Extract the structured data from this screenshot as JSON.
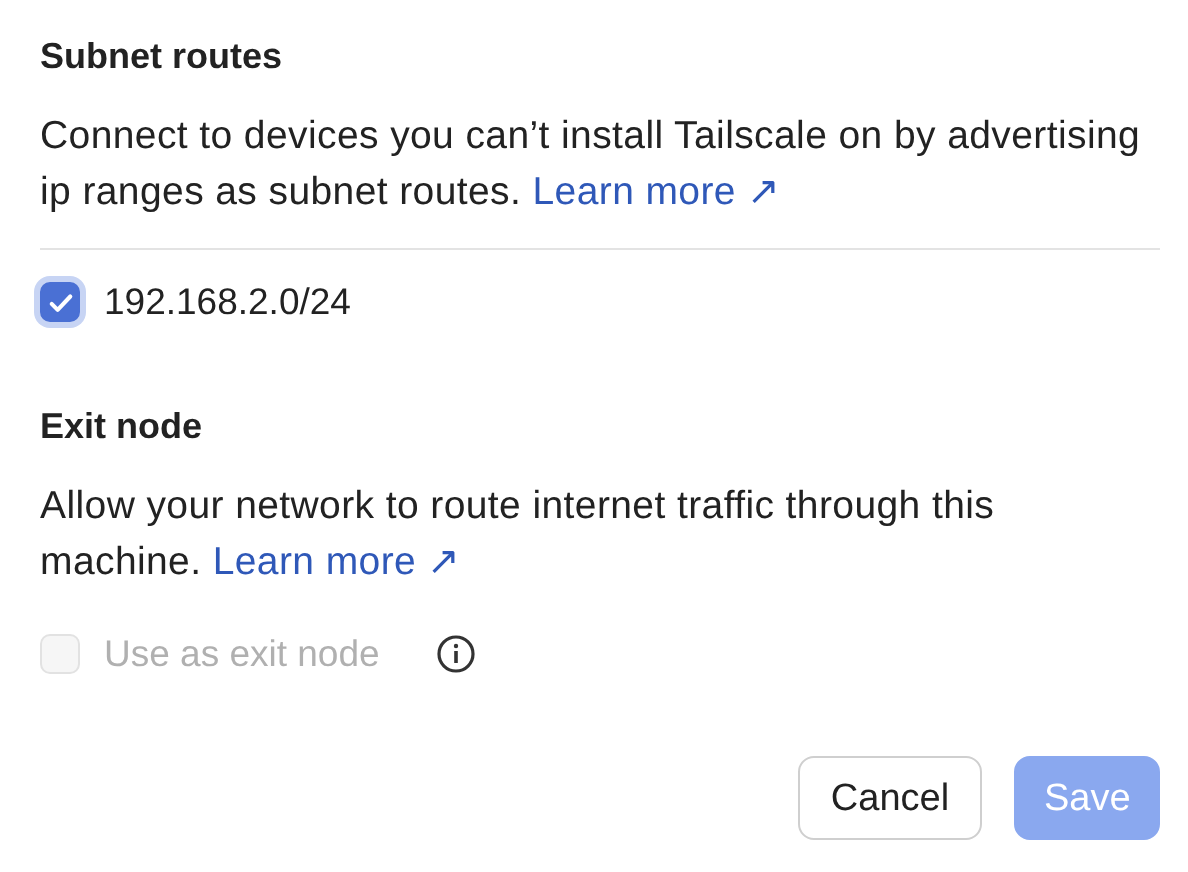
{
  "sections": [
    {
      "title": "Subnet routes",
      "description": "Connect to devices you can’t install Tailscale on by advertising ip ranges as subnet routes.",
      "link": "Learn more ↗",
      "divider": true,
      "options": [
        {
          "label": "192.168.2.0/24",
          "checked": true,
          "disabled": false,
          "info": false
        }
      ]
    },
    {
      "title": "Exit node",
      "description": "Allow your network to route internet traffic through this machine.",
      "link": "Learn more ↗",
      "divider": false,
      "options": [
        {
          "label": "Use as exit node",
          "checked": false,
          "disabled": true,
          "info": true
        }
      ]
    }
  ],
  "buttons": [
    {
      "label": "Cancel",
      "kind": "secondary",
      "disabled": false
    },
    {
      "label": "Save",
      "kind": "primary",
      "disabled": true
    }
  ]
}
